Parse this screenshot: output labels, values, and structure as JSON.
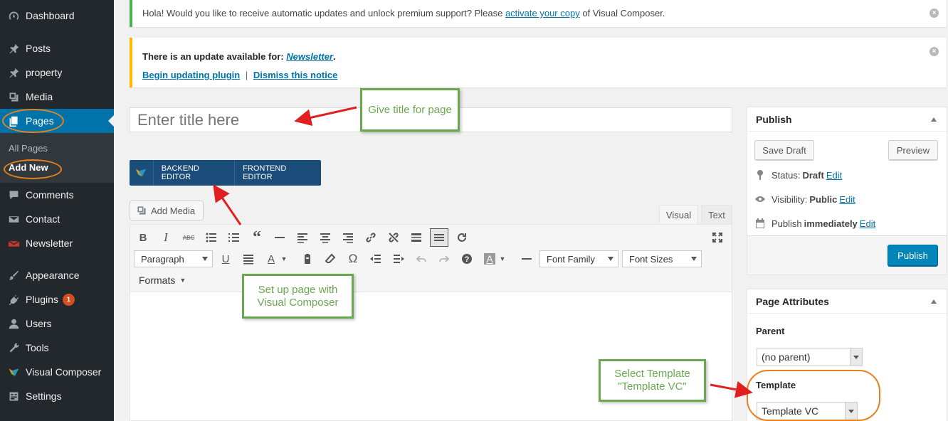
{
  "sidebar": {
    "items": [
      {
        "label": "Dashboard",
        "icon": "dashboard-icon"
      },
      {
        "label": "Posts",
        "icon": "pin-icon"
      },
      {
        "label": "property",
        "icon": "pin-icon"
      },
      {
        "label": "Media",
        "icon": "media-icon"
      },
      {
        "label": "Pages",
        "icon": "pages-icon"
      },
      {
        "label": "Comments",
        "icon": "comments-icon"
      },
      {
        "label": "Contact",
        "icon": "mail-icon"
      },
      {
        "label": "Newsletter",
        "icon": "newsletter-icon"
      },
      {
        "label": "Appearance",
        "icon": "brush-icon"
      },
      {
        "label": "Plugins",
        "icon": "plugin-icon",
        "badge": "1"
      },
      {
        "label": "Users",
        "icon": "users-icon"
      },
      {
        "label": "Tools",
        "icon": "wrench-icon"
      },
      {
        "label": "Visual Composer",
        "icon": "vc-logo-icon"
      },
      {
        "label": "Settings",
        "icon": "settings-icon"
      }
    ],
    "submenu": {
      "all_pages": "All Pages",
      "add_new": "Add New"
    }
  },
  "notices": {
    "vc": {
      "text_before": "Hola! Would you like to receive automatic updates and unlock premium support? Please ",
      "link": "activate your copy",
      "text_after": " of Visual Composer."
    },
    "update": {
      "text_before": "There is an update available for: ",
      "plugin_link": "Newsletter",
      "text_after": ".",
      "begin_link": "Begin updating plugin",
      "separator": "|",
      "dismiss_link": "Dismiss this notice"
    }
  },
  "title_placeholder": "Enter title here",
  "vc_bar": {
    "backend": "BACKEND EDITOR",
    "frontend": "FRONTEND EDITOR"
  },
  "editor": {
    "add_media": "Add Media",
    "tab_visual": "Visual",
    "tab_text": "Text",
    "paragraph": "Paragraph",
    "font_family": "Font Family",
    "font_sizes": "Font Sizes",
    "formats": "Formats"
  },
  "publish": {
    "title": "Publish",
    "save_draft": "Save Draft",
    "preview": "Preview",
    "status_label": "Status: ",
    "status_value": "Draft",
    "visibility_label": "Visibility: ",
    "visibility_value": "Public",
    "publish_label": "Publish ",
    "publish_value": "immediately",
    "edit": "Edit",
    "publish_button": "Publish"
  },
  "page_attributes": {
    "title": "Page Attributes",
    "parent_label": "Parent",
    "parent_value": "(no parent)",
    "template_label": "Template",
    "template_value": "Template VC"
  },
  "annotations": {
    "title_note": "Give title for page",
    "vc_note": "Set up page with Visual Composer",
    "template_note": "Select Template \"Template VC\""
  },
  "colors": {
    "sidebar": "#23282d",
    "active": "#0073aa",
    "vc_bar": "#1b4d7a",
    "callout": "#6aa84f",
    "arrow": "#e02020",
    "ring": "#e8801e"
  }
}
